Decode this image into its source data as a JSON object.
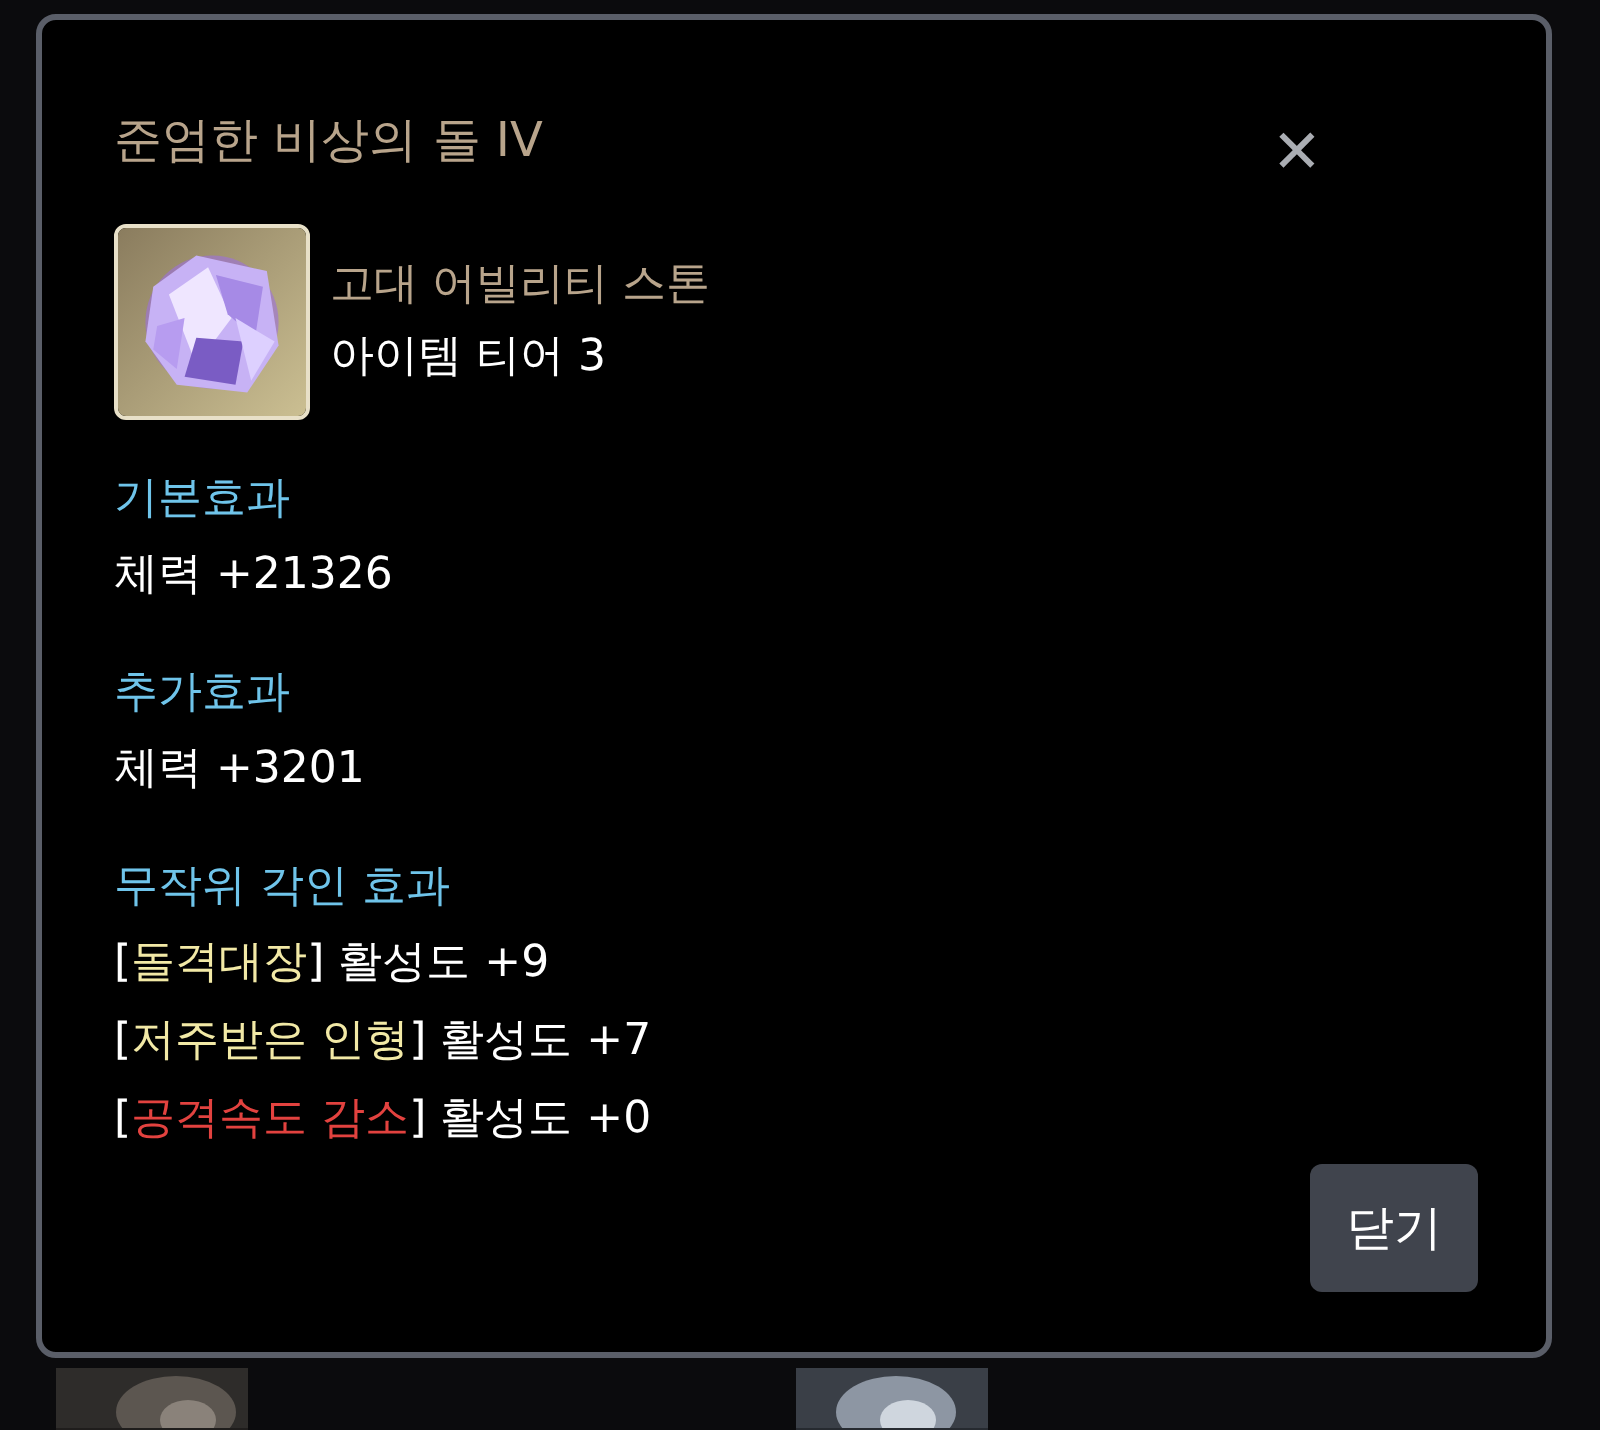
{
  "dialog": {
    "title": "준엄한 비상의 돌 IV",
    "close": "✕",
    "item": {
      "kind": "picture",
      "category": "고대 어빌리티 스톤",
      "tier": "아이템 티어 3"
    },
    "sections": [
      {
        "heading": "기본효과",
        "lines": [
          {
            "text": "체력 +21326"
          }
        ]
      },
      {
        "heading": "추가효과",
        "lines": [
          {
            "text": "체력 +3201"
          }
        ]
      },
      {
        "heading": "무작위 각인 효과",
        "engravings": [
          {
            "open": "[",
            "name": "돌격대장",
            "close": "]",
            "value": "활성도 +9",
            "color": "#f2e9a6"
          },
          {
            "open": "[",
            "name": "저주받은 인형",
            "close": "]",
            "value": "활성도 +7",
            "color": "#f2e9a6"
          },
          {
            "open": "[",
            "name": "공격속도 감소",
            "close": "]",
            "value": "활성도 +0",
            "color": "#e2423f"
          }
        ]
      }
    ],
    "button": "닫기"
  }
}
